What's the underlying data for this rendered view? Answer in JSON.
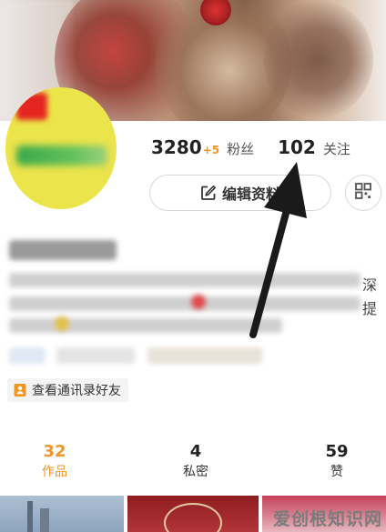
{
  "profile": {
    "fans_count": "3280",
    "fans_delta": "+5",
    "fans_label": "粉丝",
    "following_count": "102",
    "following_label": "关注",
    "edit_label": "编辑资料",
    "side_chars": [
      "深",
      "提"
    ]
  },
  "contacts": {
    "label": "查看通讯录好友"
  },
  "tabs": [
    {
      "count": "32",
      "label": "作品",
      "active": true
    },
    {
      "count": "4",
      "label": "私密",
      "active": false
    },
    {
      "count": "59",
      "label": "赞",
      "active": false
    }
  ],
  "watermark": "爱创根知识网",
  "colors": {
    "accent": "#f19524",
    "avatar_bg": "#ece44b"
  },
  "icons": [
    "edit-icon",
    "qr-code-icon",
    "contacts-icon",
    "annotation-arrow"
  ]
}
